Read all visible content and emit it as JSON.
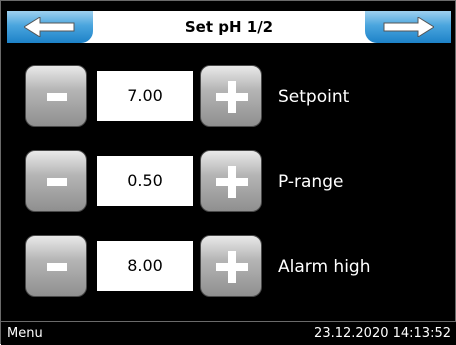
{
  "header": {
    "title": "Set pH 1/2",
    "prev_icon": "arrow-left-icon",
    "next_icon": "arrow-right-icon"
  },
  "rows": [
    {
      "minus_icon": "minus-icon",
      "value": "7.00",
      "plus_icon": "plus-icon",
      "label": "Setpoint"
    },
    {
      "minus_icon": "minus-icon",
      "value": "0.50",
      "plus_icon": "plus-icon",
      "label": "P-range"
    },
    {
      "minus_icon": "minus-icon",
      "value": "8.00",
      "plus_icon": "plus-icon",
      "label": "Alarm high"
    }
  ],
  "status_bar": {
    "menu_label": "Menu",
    "datetime": "23.12.2020 14:13:52"
  },
  "colors": {
    "background": "#000000",
    "nav_button_blue": "#4aa5de",
    "button_gray": "#b5b5b5",
    "text": "#ffffff"
  }
}
